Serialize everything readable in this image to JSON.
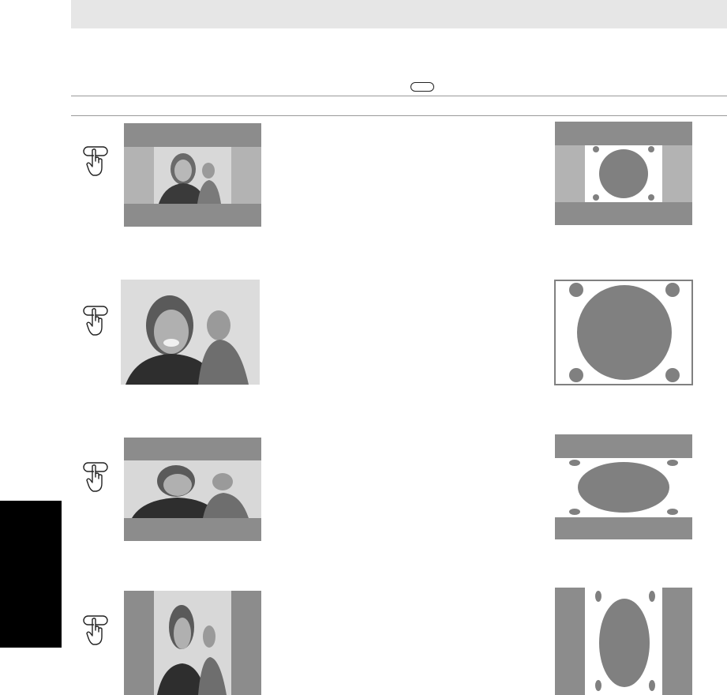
{
  "page": {
    "header_band": "",
    "reference_key": "",
    "colors": {
      "band": "#e6e6e6",
      "bar": "#8c8c8c",
      "side": "#b3b3b3",
      "shape": "#808080",
      "tab": "#000000"
    }
  },
  "steps": [
    {
      "icon": "pointing-hand-icon",
      "example": "picture-zoom-example",
      "diagram": "circle-with-side-bars"
    },
    {
      "icon": "pointing-hand-icon",
      "example": "picture-full-example",
      "diagram": "circle-full-screen"
    },
    {
      "icon": "pointing-hand-icon",
      "example": "picture-wide-zoom-example",
      "diagram": "ellipse-letterbox"
    },
    {
      "icon": "pointing-hand-icon",
      "example": "picture-4-3-example",
      "diagram": "ellipse-pillarbox"
    }
  ]
}
